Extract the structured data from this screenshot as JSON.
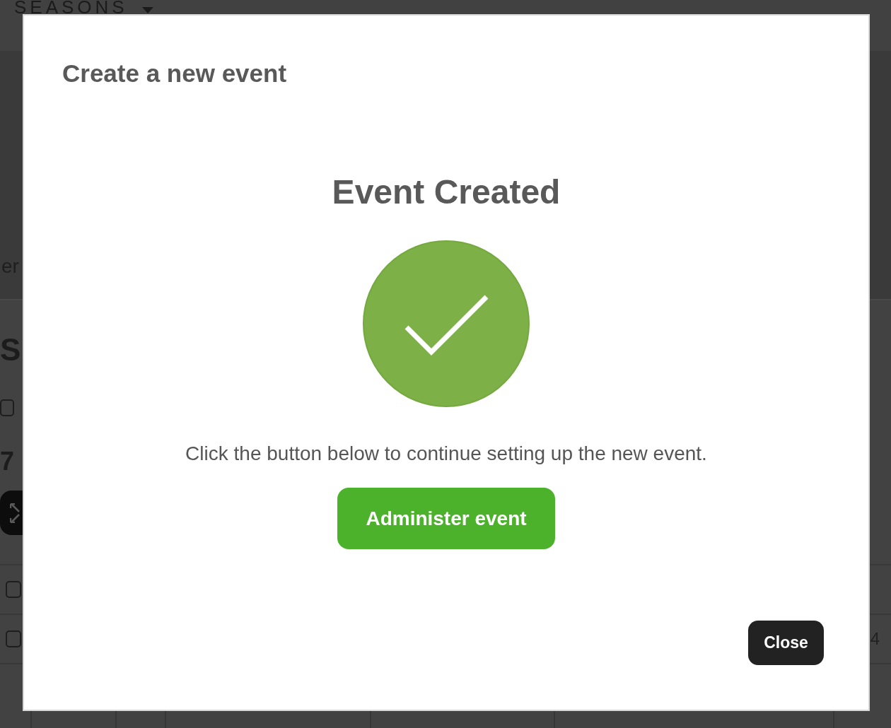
{
  "background_page": {
    "brand": "SEASONS",
    "nav_fragment": "er",
    "heading_fragment": "S",
    "select_all": {
      "checked": false
    },
    "count_fragment": "7",
    "rows": [
      {
        "checked": false
      },
      {
        "checked": false,
        "last_cell": "4"
      }
    ]
  },
  "dialog": {
    "title": "Create a new event",
    "heading": "Event Created",
    "message": "Click the button below to continue setting up the new event.",
    "primary_button": "Administer event",
    "close_button": "Close"
  }
}
